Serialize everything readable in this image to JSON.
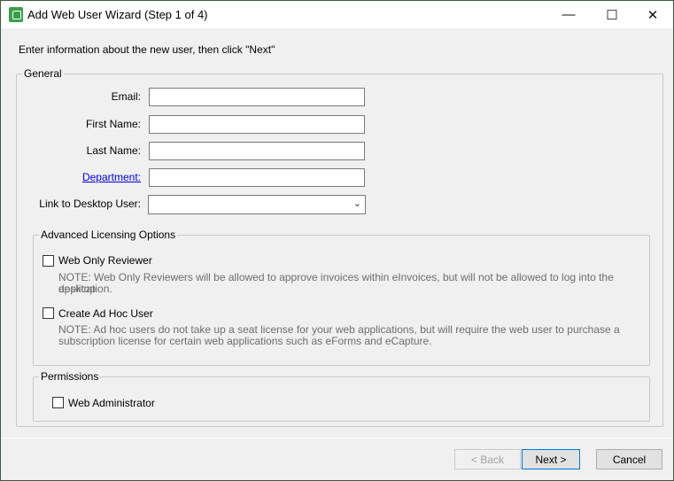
{
  "window": {
    "title": "Add Web User Wizard (Step 1 of 4)",
    "minimize": "—",
    "maximize": "☐",
    "close": "✕"
  },
  "instruction": "Enter information about the new user, then click \"Next\"",
  "general": {
    "legend": "General",
    "email_label": "Email:",
    "email_value": "",
    "first_name_label": "First Name:",
    "first_name_value": "",
    "last_name_label": "Last Name:",
    "last_name_value": "",
    "department_label": "Department:",
    "department_value": "",
    "link_desktop_label": "Link to Desktop User:",
    "link_desktop_value": ""
  },
  "advanced": {
    "legend": "Advanced Licensing Options",
    "web_only_label": "Web Only Reviewer",
    "web_only_checked": false,
    "web_only_note1": "NOTE: Web Only Reviewers will be allowed to approve invoices within eInvoices, but will not be allowed to log into the desktop",
    "web_only_note2": "application.",
    "adhoc_label": "Create Ad Hoc User",
    "adhoc_checked": false,
    "adhoc_note1": "NOTE: Ad hoc users do not take up a seat license for your web applications, but will require the web user to purchase a",
    "adhoc_note2": "subscription license for certain web applications such as eForms and eCapture."
  },
  "permissions": {
    "legend": "Permissions",
    "web_admin_label": "Web Administrator",
    "web_admin_checked": false
  },
  "buttons": {
    "back": "< Back",
    "next": "Next >",
    "cancel": "Cancel"
  },
  "colors": {
    "link": "#0000ee",
    "disabled": "#a0a0a0",
    "app_icon": "#3aa04a"
  }
}
